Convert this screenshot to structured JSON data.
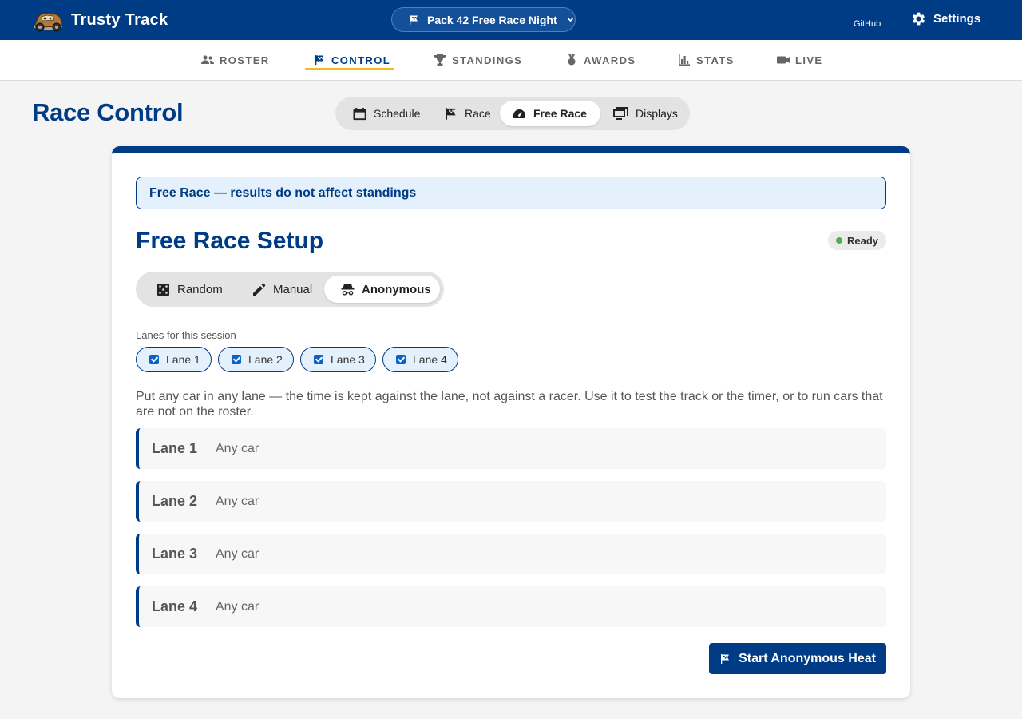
{
  "brand": {
    "name": "Trusty Track",
    "logo_icon": "race-car-logo"
  },
  "event": {
    "label": "Pack 42 Free Race Night"
  },
  "header_links": {
    "github": "GitHub",
    "settings": "Settings"
  },
  "nav": {
    "items": [
      {
        "label": "ROSTER",
        "icon": "users-icon"
      },
      {
        "label": "CONTROL",
        "icon": "flag-icon",
        "active": true
      },
      {
        "label": "STANDINGS",
        "icon": "trophy-icon"
      },
      {
        "label": "AWARDS",
        "icon": "medal-icon"
      },
      {
        "label": "STATS",
        "icon": "bar-chart-icon"
      },
      {
        "label": "LIVE",
        "icon": "video-icon"
      }
    ]
  },
  "page": {
    "title": "Race Control",
    "tabs": [
      {
        "label": "Schedule",
        "icon": "calendar-icon"
      },
      {
        "label": "Race",
        "icon": "flag-icon"
      },
      {
        "label": "Free Race",
        "icon": "gauge-icon",
        "active": true
      },
      {
        "label": "Displays",
        "icon": "monitor-icon"
      }
    ]
  },
  "card": {
    "banner": "Free Race — results do not affect standings",
    "title": "Free Race Setup",
    "status": "Ready",
    "modes": [
      {
        "label": "Random",
        "icon": "dice-icon"
      },
      {
        "label": "Manual",
        "icon": "pencil-icon"
      },
      {
        "label": "Anonymous",
        "icon": "incognito-icon",
        "active": true
      }
    ],
    "lanes_label": "Lanes for this session",
    "lane_chips": [
      {
        "label": "Lane 1",
        "checked": true
      },
      {
        "label": "Lane 2",
        "checked": true
      },
      {
        "label": "Lane 3",
        "checked": true
      },
      {
        "label": "Lane 4",
        "checked": true
      }
    ],
    "description": "Put any car in any lane — the time is kept against the lane, not against a racer. Use it to test the track or the timer, or to run cars that are not on the roster.",
    "lanes": [
      {
        "name": "Lane 1",
        "car": "Any car"
      },
      {
        "name": "Lane 2",
        "car": "Any car"
      },
      {
        "name": "Lane 3",
        "car": "Any car"
      },
      {
        "name": "Lane 4",
        "car": "Any car"
      }
    ],
    "start_button": "Start Anonymous Heat"
  },
  "colors": {
    "primary": "#003b85",
    "accent": "#f5b81c",
    "status_ready": "#4caf50",
    "banner_bg": "#e4f0fb"
  }
}
